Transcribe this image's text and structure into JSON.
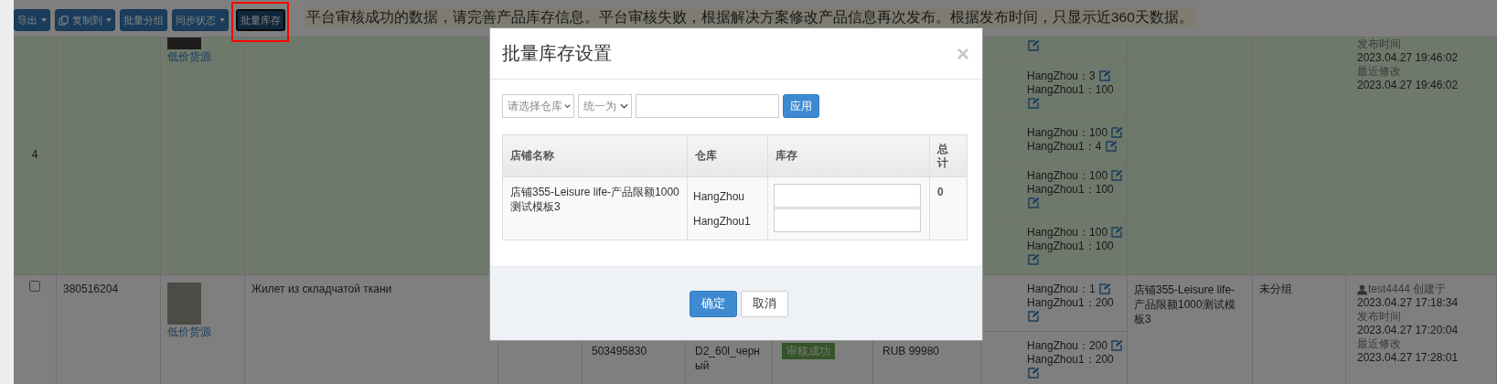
{
  "toolbar": {
    "buttons": [
      {
        "label": "导出",
        "dropdown": true,
        "has_icon": false,
        "pressed": false
      },
      {
        "label": "复制到",
        "dropdown": true,
        "has_icon": true,
        "pressed": false
      },
      {
        "label": "批量分组",
        "dropdown": false,
        "has_icon": false,
        "pressed": false
      },
      {
        "label": "同步状态",
        "dropdown": true,
        "has_icon": false,
        "pressed": false
      },
      {
        "label": "批量库存",
        "dropdown": false,
        "has_icon": false,
        "pressed": true
      }
    ],
    "notice": "平台审核成功的数据，请完善产品库存信息。平台审核失败，根据解决方案修改产品信息再次发布。根据发布时间，只显示近360天数据。"
  },
  "table": {
    "rows": [
      {
        "highlighted": true,
        "number": "4",
        "link": "低价货源",
        "variants": [
          {
            "kind": "clipped"
          },
          {
            "kind": "full",
            "stock": [
              {
                "text": "HangZhou：3"
              },
              {
                "text": "HangZhou1：100"
              }
            ]
          },
          {
            "kind": "full",
            "stock": [
              {
                "text": "HangZhou：100"
              },
              {
                "text": "HangZhou1：4"
              }
            ]
          },
          {
            "kind": "full",
            "stock": [
              {
                "text": "HangZhou：100"
              },
              {
                "text": "HangZhou1：100"
              }
            ]
          },
          {
            "kind": "full",
            "stock": [
              {
                "text": "HangZhou：100"
              },
              {
                "text": "HangZhou1：100"
              }
            ]
          }
        ],
        "times": [
          {
            "kind": "label",
            "text": "发布时间"
          },
          {
            "kind": "value",
            "text": "2023.04.27 19:46:02"
          },
          {
            "kind": "label",
            "text": "最近修改"
          },
          {
            "kind": "value",
            "text": "2023.04.27 19:46:02"
          }
        ]
      },
      {
        "highlighted": false,
        "checked": false,
        "id": "380516204",
        "link": "低价货源",
        "title": "Жилет из складчатой ткани",
        "variants": [
          {
            "kind": "full",
            "stock": [
              {
                "text": "HangZhou：1"
              },
              {
                "text": "HangZhou1：200"
              }
            ]
          },
          {
            "kind": "full",
            "sku": "503495830",
            "name": "D2_60l_черный",
            "status": "审核成功",
            "price": "RUB 99980",
            "stock": [
              {
                "text": "HangZhou：200"
              },
              {
                "text": "HangZhou1：200"
              }
            ]
          }
        ],
        "store": "店铺355-Leisure life-产品限额1000测试模板3",
        "group": "未分组",
        "times": [
          {
            "kind": "user",
            "text": "test4444 创建于"
          },
          {
            "kind": "value",
            "text": "2023.04.27 17:18:34"
          },
          {
            "kind": "label",
            "text": "发布时间"
          },
          {
            "kind": "value",
            "text": "2023.04.27 17:20:04"
          },
          {
            "kind": "label",
            "text": "最近修改"
          },
          {
            "kind": "value",
            "text": "2023.04.27 17:28:01"
          }
        ]
      }
    ]
  },
  "modal": {
    "title": "批量库存设置",
    "close": "×",
    "warehouse_select": "请选择仓库",
    "mode_select": "统一为",
    "apply_button": "应用",
    "table": {
      "columns": [
        "店铺名称",
        "仓库",
        "库存",
        "总计"
      ],
      "rows": [
        {
          "store": "店铺355-Leisure life-产品限额1000测试模板3",
          "warehouses": [
            "HangZhou",
            "HangZhou1"
          ],
          "total": "0"
        }
      ]
    },
    "buttons": [
      {
        "label": "确定",
        "primary": true
      },
      {
        "label": "取消",
        "primary": false
      }
    ]
  }
}
